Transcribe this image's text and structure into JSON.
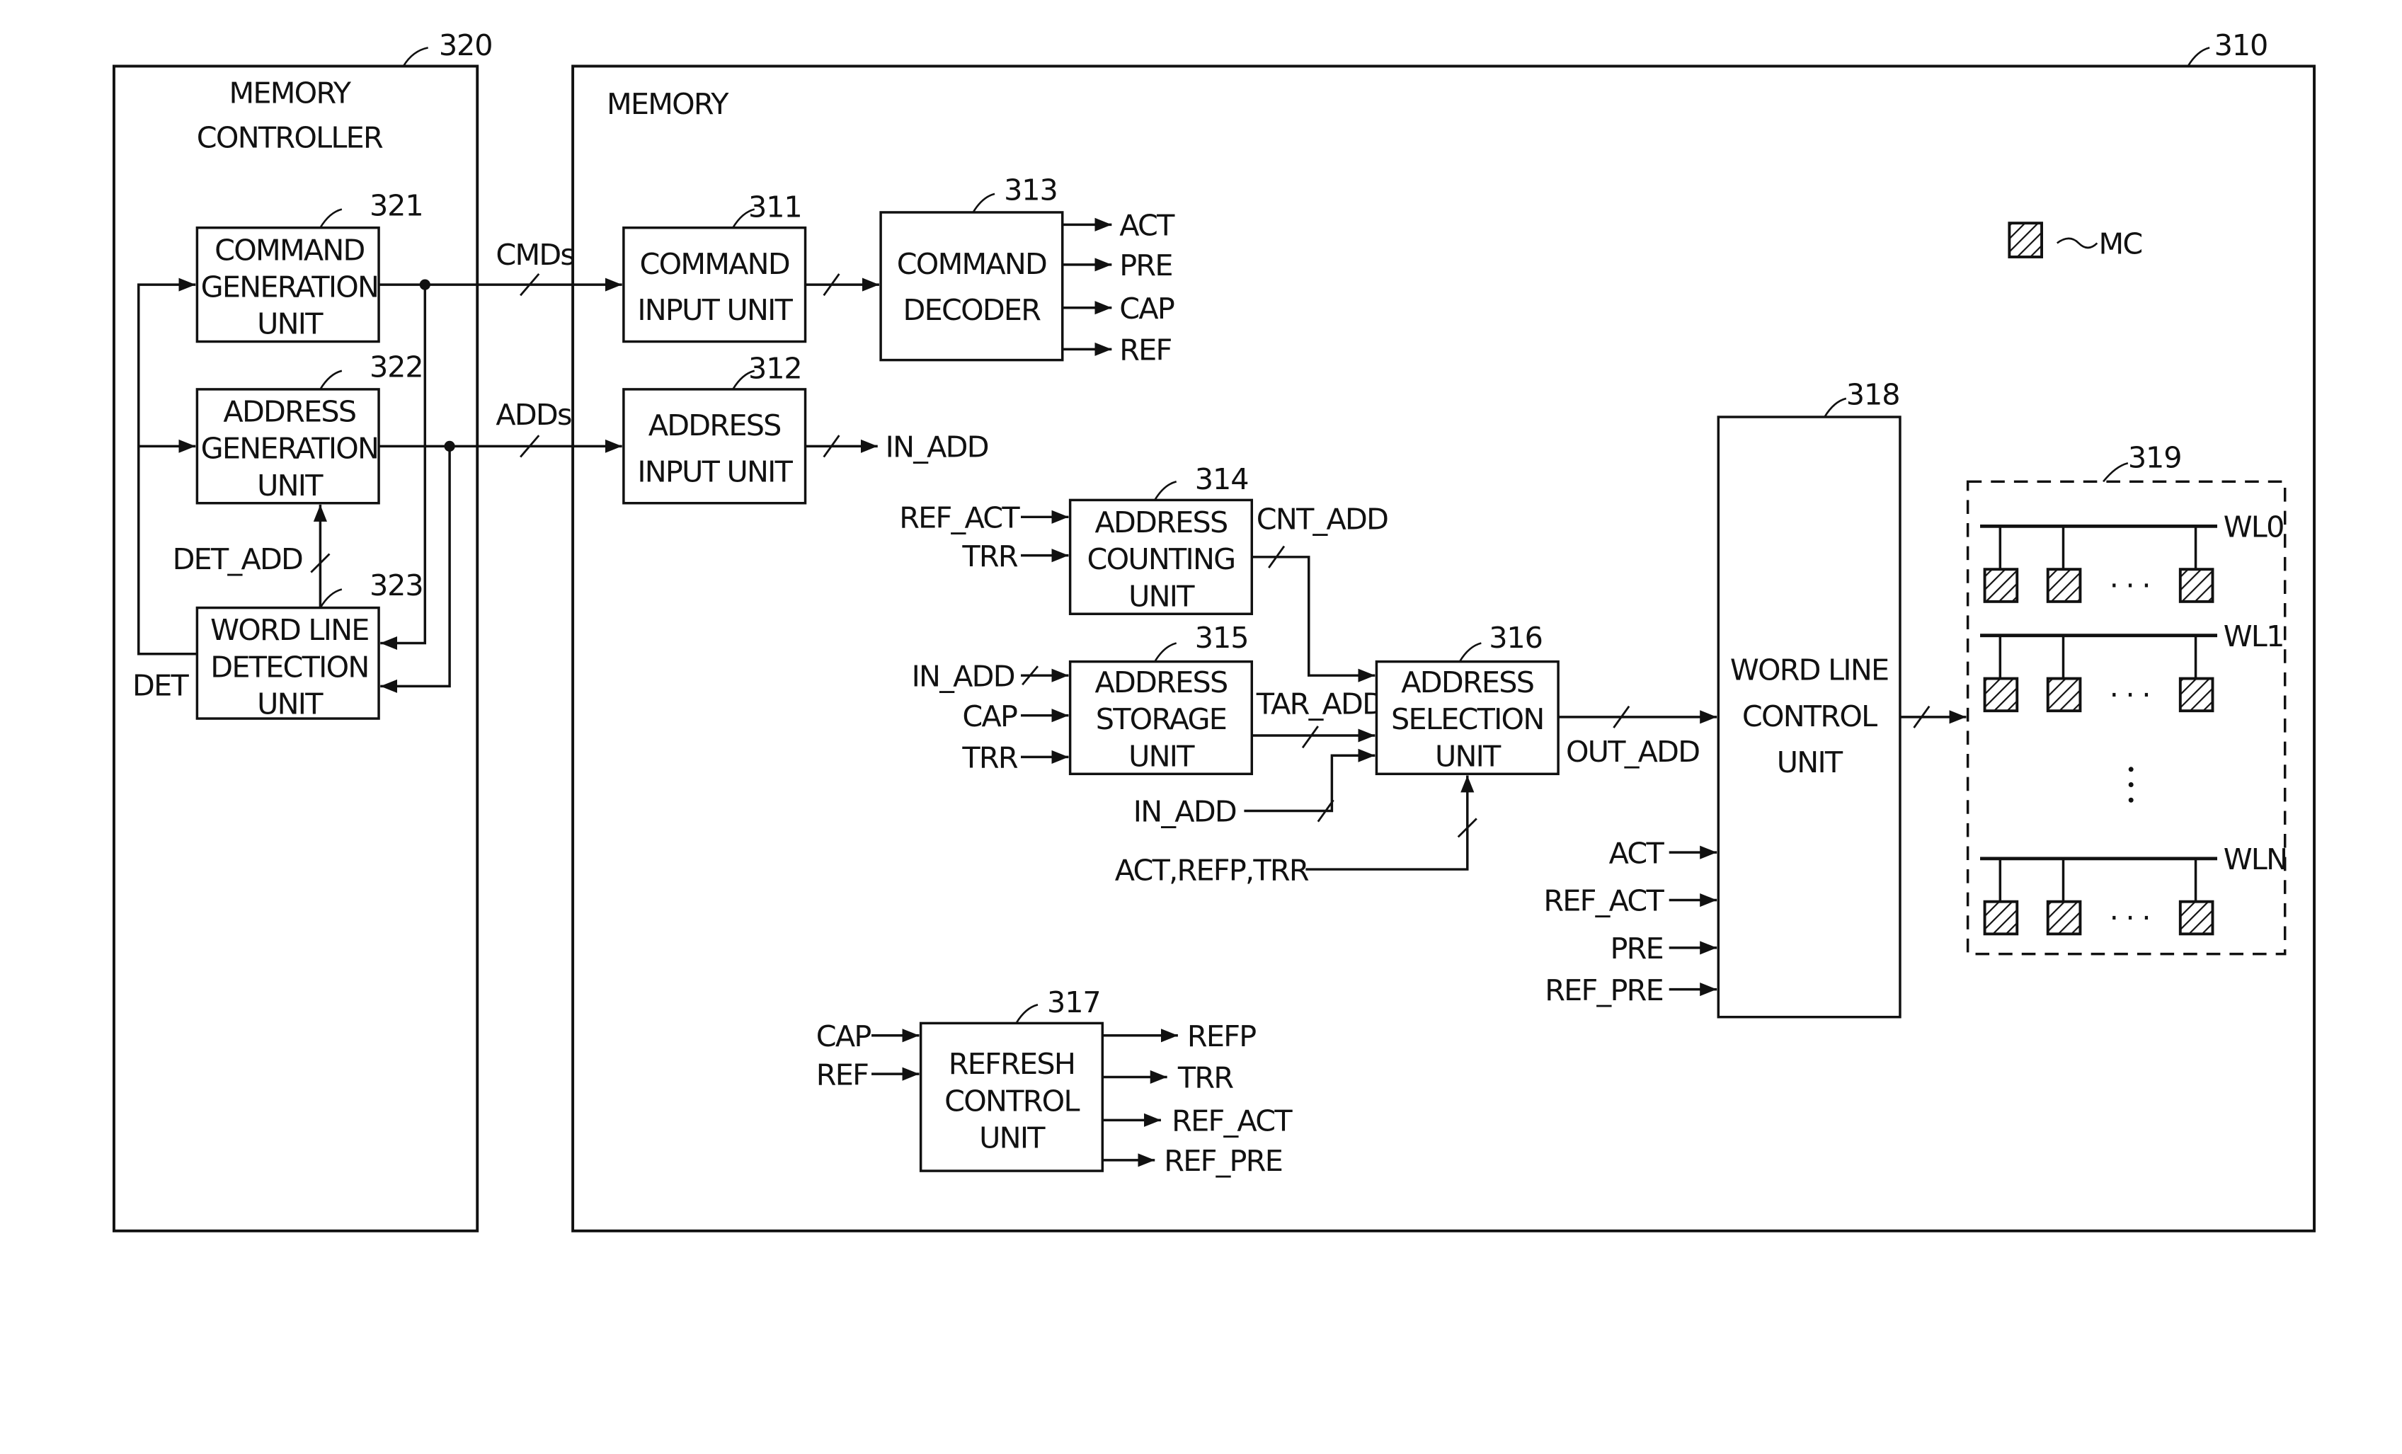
{
  "memory_controller": {
    "ref": "320",
    "title_line1": "MEMORY",
    "title_line2": "CONTROLLER",
    "command_generation_unit": {
      "ref": "321",
      "lines": [
        "COMMAND",
        "GENERATION",
        "UNIT"
      ]
    },
    "address_generation_unit": {
      "ref": "322",
      "lines": [
        "ADDRESS",
        "GENERATION",
        "UNIT"
      ]
    },
    "word_line_detection_unit": {
      "ref": "323",
      "lines": [
        "WORD LINE",
        "DETECTION",
        "UNIT"
      ]
    },
    "signals": {
      "det_add": "DET_ADD",
      "det": "DET"
    }
  },
  "bus_labels": {
    "cmds": "CMDs",
    "adds": "ADDs"
  },
  "memory": {
    "ref": "310",
    "title": "MEMORY",
    "legend": {
      "symbol": "hatched-cell",
      "label": "MC"
    },
    "command_input_unit": {
      "ref": "311",
      "lines": [
        "COMMAND",
        "INPUT UNIT"
      ]
    },
    "address_input_unit": {
      "ref": "312",
      "lines": [
        "ADDRESS",
        "INPUT UNIT"
      ],
      "output": "IN_ADD"
    },
    "command_decoder": {
      "ref": "313",
      "lines": [
        "COMMAND",
        "DECODER"
      ],
      "outputs": [
        "ACT",
        "PRE",
        "CAP",
        "REF"
      ]
    },
    "address_counting_unit": {
      "ref": "314",
      "lines": [
        "ADDRESS",
        "COUNTING",
        "UNIT"
      ],
      "inputs": [
        "REF_ACT",
        "TRR"
      ],
      "output": "CNT_ADD"
    },
    "address_storage_unit": {
      "ref": "315",
      "lines": [
        "ADDRESS",
        "STORAGE",
        "UNIT"
      ],
      "inputs": [
        "IN_ADD",
        "CAP",
        "TRR"
      ],
      "output": "TAR_ADD"
    },
    "address_selection_unit": {
      "ref": "316",
      "lines": [
        "ADDRESS",
        "SELECTION",
        "UNIT"
      ],
      "extra_inputs": [
        "IN_ADD",
        "ACT,REFP,TRR"
      ],
      "output": "OUT_ADD"
    },
    "refresh_control_unit": {
      "ref": "317",
      "lines": [
        "REFRESH",
        "CONTROL",
        "UNIT"
      ],
      "inputs": [
        "CAP",
        "REF"
      ],
      "outputs": [
        "REFP",
        "TRR",
        "REF_ACT",
        "REF_PRE"
      ]
    },
    "word_line_control_unit": {
      "ref": "318",
      "lines": [
        "WORD LINE",
        "CONTROL",
        "UNIT"
      ],
      "inputs": [
        "ACT",
        "REF_ACT",
        "PRE",
        "REF_PRE"
      ]
    },
    "cell_array": {
      "ref": "319",
      "word_lines": [
        "WL0",
        "WL1",
        "WLN"
      ],
      "ellipsis": "· · ·"
    }
  }
}
